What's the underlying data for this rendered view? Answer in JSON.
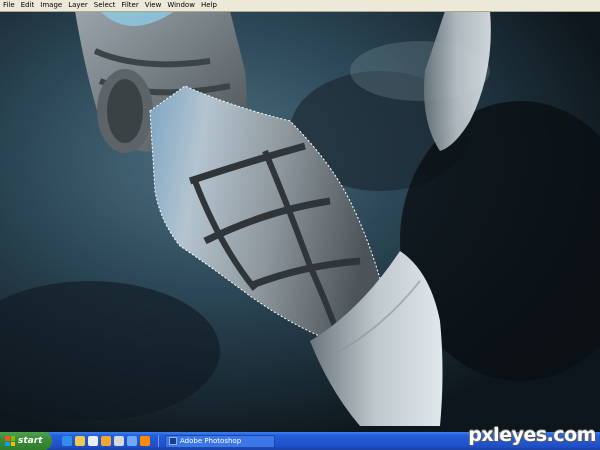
{
  "menu": [
    "File",
    "Edit",
    "Image",
    "Layer",
    "Select",
    "Filter",
    "View",
    "Window",
    "Help"
  ],
  "taskbar": {
    "start_label": "start",
    "task_label": "Adobe Photoshop",
    "quick_launch": [
      "ie-icon",
      "folder-icon",
      "media-icon",
      "app-icon",
      "settings-icon",
      "desktop-icon",
      "vlc-icon"
    ]
  },
  "watermark": "pxleyes.com",
  "colors": {
    "menu_bg": "#ece9d8",
    "taskbar_blue": "#245edb",
    "start_green": "#3a8d36"
  }
}
